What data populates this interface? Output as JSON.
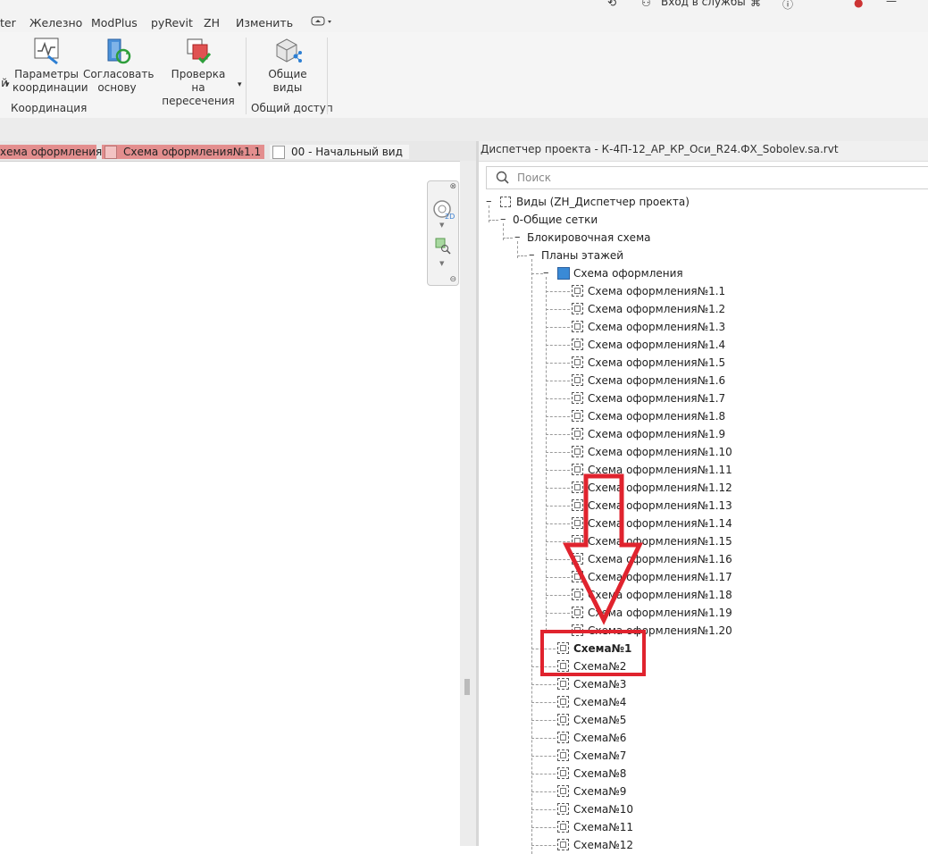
{
  "menu": {
    "items": [
      "ter",
      "Железно",
      "ModPlus",
      "pyRevit",
      "ZH",
      "Изменить"
    ],
    "top_right_text": "Вход в службы"
  },
  "ribbon": {
    "buttons": [
      {
        "line1": "Параметры",
        "line2": "координации",
        "icon": "coordination-params-icon"
      },
      {
        "line1": "Согласовать",
        "line2": "основу",
        "icon": "reconcile-icon"
      },
      {
        "line1": "Проверка",
        "line2": "на пересечения",
        "icon": "clash-check-icon"
      },
      {
        "line1": "Общие",
        "line2": "виды",
        "icon": "shared-views-icon"
      }
    ],
    "panels": [
      "Координация",
      "Общий доступ"
    ],
    "partial_left_label": "й"
  },
  "tabs": [
    {
      "label": "хема оформления",
      "active": true
    },
    {
      "label": "Схема оформления№1.1",
      "active": true
    },
    {
      "label": "00 - Начальный вид",
      "active": false
    }
  ],
  "project_browser": {
    "title": "Диспетчер проекта - К-4П-12_АР_КР_Оси_R24.ФХ_Sobolev.sa.rvt",
    "search_placeholder": "Поиск",
    "root": "Виды (ZH_Диспетчер проекта)",
    "level1": "0-Общие сетки",
    "level2": "Блокировочная схема",
    "level3": "Планы этажей",
    "level4": "Схема оформления",
    "children": [
      "Схема оформления№1.1",
      "Схема оформления№1.2",
      "Схема оформления№1.3",
      "Схема оформления№1.4",
      "Схема оформления№1.5",
      "Схема оформления№1.6",
      "Схема оформления№1.7",
      "Схема оформления№1.8",
      "Схема оформления№1.9",
      "Схема оформления№1.10",
      "Схема оформления№1.11",
      "Схема оформления№1.12",
      "Схема оформления№1.13",
      "Схема оформления№1.14",
      "Схема оформления№1.15",
      "Схема оформления№1.16",
      "Схема оформления№1.17",
      "Схема оформления№1.18",
      "Схема оформления№1.19",
      "Схема оформления№1.20"
    ],
    "schemes": [
      "Схема№1",
      "Схема№2",
      "Схема№3",
      "Схема№4",
      "Схема№5",
      "Схема№6",
      "Схема№7",
      "Схема№8",
      "Схема№9",
      "Схема№10",
      "Схема№11",
      "Схема№12"
    ],
    "bold_item": "Схема№1"
  },
  "colors": {
    "annotation_red": "#e0232e",
    "tab_active": "#e38e8e",
    "folder_blue": "#3a8ad6"
  }
}
